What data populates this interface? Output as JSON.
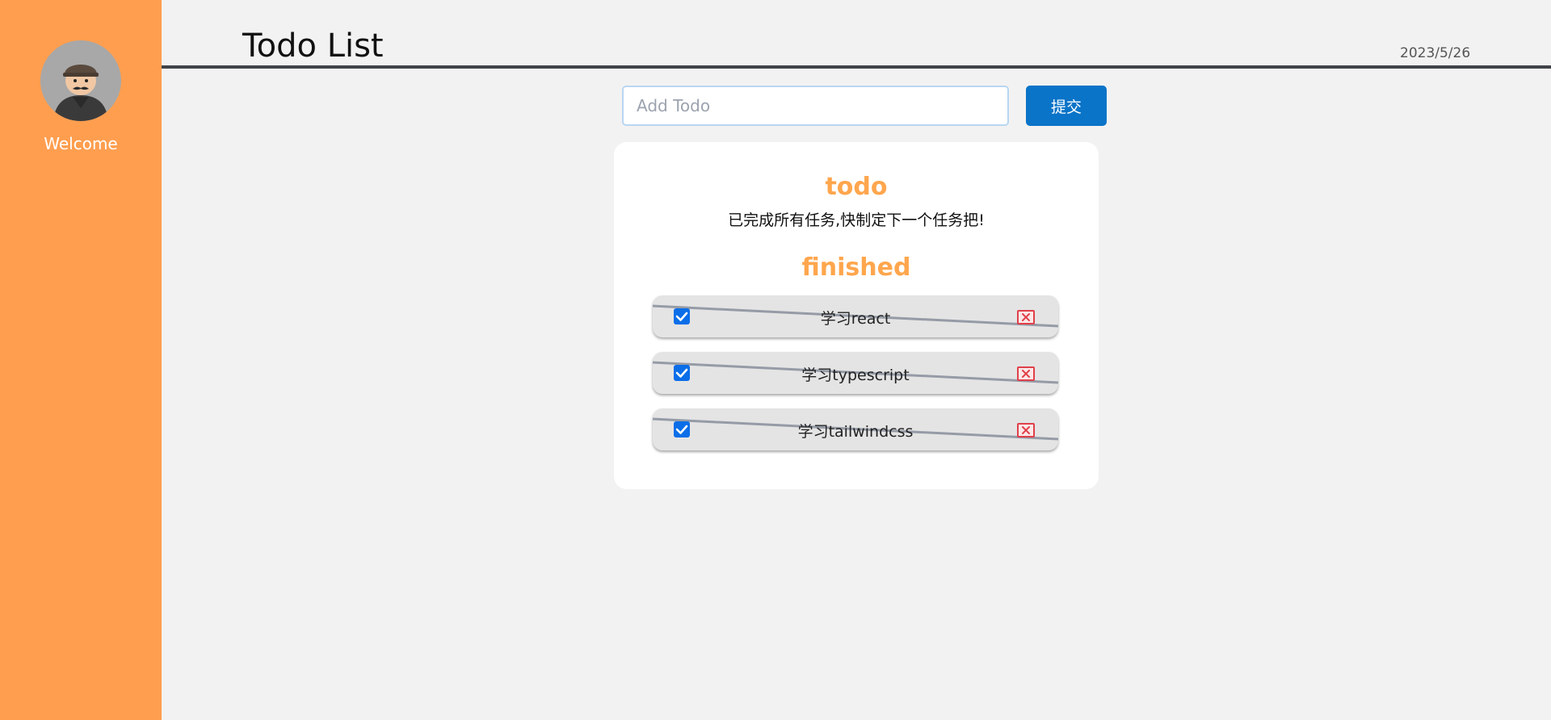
{
  "sidebar": {
    "avatar_icon": "user-avatar-icon",
    "welcome_label": "Welcome",
    "background_color": "#ff9e4f"
  },
  "header": {
    "title": "Todo List",
    "date": "2023/5/26"
  },
  "add_form": {
    "input_value": "",
    "input_placeholder": "Add Todo",
    "submit_label": "提交",
    "submit_color": "#0a74c8"
  },
  "todo_section": {
    "heading": "todo",
    "empty_message": "已完成所有任务,快制定下一个任务把!"
  },
  "finished_section": {
    "heading": "finished",
    "items": [
      {
        "label": "学习react",
        "checked": true,
        "delete_icon": "close-icon"
      },
      {
        "label": "学习typescript",
        "checked": true,
        "delete_icon": "close-icon"
      },
      {
        "label": "学习tailwindcss",
        "checked": true,
        "delete_icon": "close-icon"
      }
    ]
  },
  "accent_color": "#ffa64d"
}
